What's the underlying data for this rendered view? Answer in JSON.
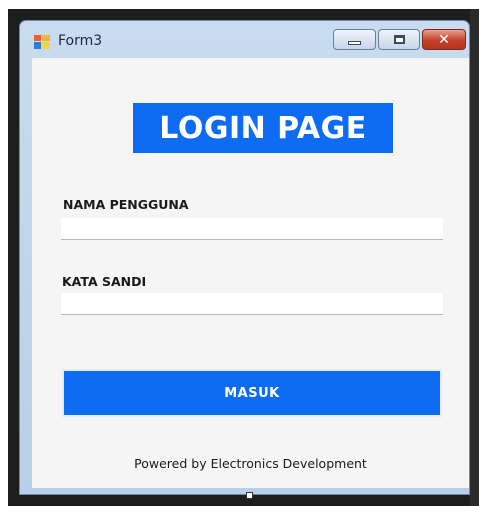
{
  "window": {
    "title": "Form3",
    "minimize_label": "minimize",
    "maximize_label": "maximize",
    "close_label": "close",
    "icon": "form-app-icon"
  },
  "header": {
    "title": "LOGIN PAGE"
  },
  "form": {
    "username_label": "NAMA PENGGUNA",
    "username_value": "",
    "password_label": "KATA SANDI",
    "password_value": "",
    "submit_label": "MASUK"
  },
  "footer": {
    "text": "Powered by Electronics Development"
  },
  "colors": {
    "accent": "#0d6cf2",
    "client_bg": "#f5f5f5",
    "close_button": "#c4402a"
  }
}
